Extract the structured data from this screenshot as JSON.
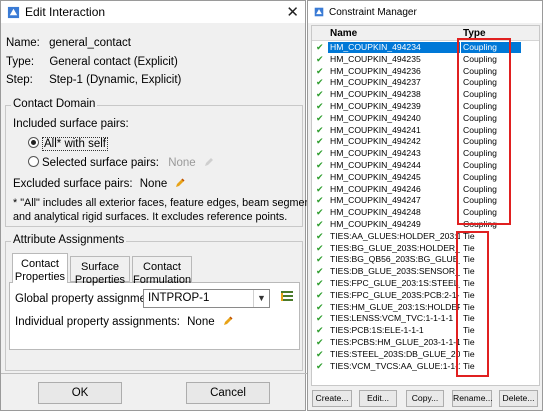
{
  "edit_interaction": {
    "title": "Edit Interaction",
    "close_glyph": "✕",
    "name_label": "Name:",
    "name_value": "general_contact",
    "type_label": "Type:",
    "type_value": "General contact (Explicit)",
    "step_label": "Step:",
    "step_value": "Step-1 (Dynamic, Explicit)",
    "contact_domain_title": "Contact Domain",
    "included_label": "Included surface pairs:",
    "all_with_self": "All* with self",
    "selected_pairs": "Selected surface pairs:",
    "selected_value": "None",
    "excluded_label": "Excluded surface pairs:",
    "excluded_value": "None",
    "note_line1": "* \"All\" includes all exterior faces, feature edges, beam segments,",
    "note_line2": "and analytical rigid surfaces. It excludes reference points.",
    "attr_title": "Attribute Assignments",
    "tabs": [
      {
        "line1": "Contact",
        "line2": "Properties"
      },
      {
        "line1": "Surface",
        "line2": "Properties"
      },
      {
        "line1": "Contact",
        "line2": "Formulation"
      }
    ],
    "global_label": "Global property assignment:",
    "global_value": "INTPROP-1",
    "individual_label": "Individual property assignments:",
    "individual_value": "None",
    "ok_label": "OK",
    "cancel_label": "Cancel"
  },
  "constraint_manager": {
    "title": "Constraint Manager",
    "col_name": "Name",
    "col_type": "Type",
    "rows": [
      {
        "name": "HM_COUPKIN_494234",
        "type": "Coupling"
      },
      {
        "name": "HM_COUPKIN_494235",
        "type": "Coupling"
      },
      {
        "name": "HM_COUPKIN_494236",
        "type": "Coupling"
      },
      {
        "name": "HM_COUPKIN_494237",
        "type": "Coupling"
      },
      {
        "name": "HM_COUPKIN_494238",
        "type": "Coupling"
      },
      {
        "name": "HM_COUPKIN_494239",
        "type": "Coupling"
      },
      {
        "name": "HM_COUPKIN_494240",
        "type": "Coupling"
      },
      {
        "name": "HM_COUPKIN_494241",
        "type": "Coupling"
      },
      {
        "name": "HM_COUPKIN_494242",
        "type": "Coupling"
      },
      {
        "name": "HM_COUPKIN_494243",
        "type": "Coupling"
      },
      {
        "name": "HM_COUPKIN_494244",
        "type": "Coupling"
      },
      {
        "name": "HM_COUPKIN_494245",
        "type": "Coupling"
      },
      {
        "name": "HM_COUPKIN_494246",
        "type": "Coupling"
      },
      {
        "name": "HM_COUPKIN_494247",
        "type": "Coupling"
      },
      {
        "name": "HM_COUPKIN_494248",
        "type": "Coupling"
      },
      {
        "name": "HM_COUPKIN_494249",
        "type": "Coupling"
      },
      {
        "name": "TIES:AA_GLUES:HOLDER_203:1-1-1-1",
        "type": "Tie"
      },
      {
        "name": "TIES:BG_GLUE_203S:HOLDER_203:1-1",
        "type": "Tie"
      },
      {
        "name": "TIES:BG_QB56_203S:BG_GLUE_203:1",
        "type": "Tie"
      },
      {
        "name": "TIES:DB_GLUE_203S:SENSOR_S5KGM",
        "type": "Tie"
      },
      {
        "name": "TIES:FPC_GLUE_203:1S:STEEL_203:1",
        "type": "Tie"
      },
      {
        "name": "TIES:FPC_GLUE_203S:PCB:2-1-1-1",
        "type": "Tie"
      },
      {
        "name": "TIES:HM_GLUE_203:1S:HOLDER_203:",
        "type": "Tie"
      },
      {
        "name": "TIES:LENSS:VCM_TVC:1-1-1-1",
        "type": "Tie"
      },
      {
        "name": "TIES:PCB:1S:ELE-1-1-1",
        "type": "Tie"
      },
      {
        "name": "TIES:PCBS:HM_GLUE_203-1-1-1",
        "type": "Tie"
      },
      {
        "name": "TIES:STEEL_203S:DB_GLUE_203:1-1-",
        "type": "Tie"
      },
      {
        "name": "TIES:VCM_TVCS:AA_GLUE:1-1-1-1",
        "type": "Tie"
      }
    ],
    "buttons": [
      "Create...",
      "Edit...",
      "Copy...",
      "Rename...",
      "Delete..."
    ],
    "highlight_color": "#e02020"
  }
}
